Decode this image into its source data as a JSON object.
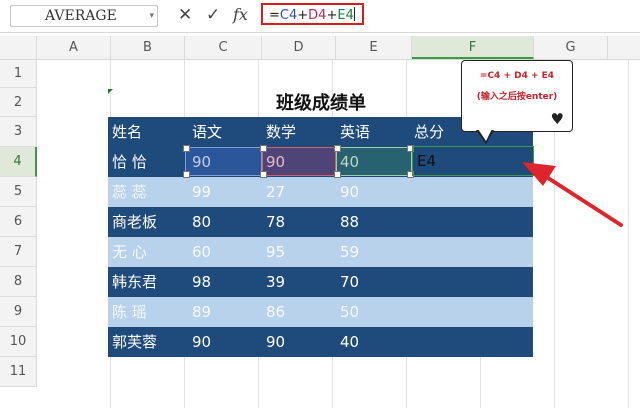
{
  "formula_bar": {
    "name_box": "AVERAGE",
    "cancel_icon": "✕",
    "confirm_icon": "✓",
    "fx_label": "fx",
    "formula": {
      "prefix": "=",
      "c_ref": "C4",
      "plus1": "+",
      "d_ref": "D4",
      "plus2": "+",
      "e_ref": "E4"
    }
  },
  "columns": [
    "A",
    "B",
    "C",
    "D",
    "E",
    "F",
    "G"
  ],
  "rows": [
    "1",
    "2",
    "3",
    "4",
    "5",
    "6",
    "7",
    "8",
    "9",
    "10",
    "11"
  ],
  "sheet": {
    "title": "班级成绩单",
    "headers": [
      "姓名",
      "语文",
      "数学",
      "英语",
      "总分"
    ],
    "records": [
      {
        "name": "恰  恰",
        "chinese": "90",
        "math": "90",
        "english": "40",
        "total": "E4"
      },
      {
        "name": "蕊  蕊",
        "chinese": "99",
        "math": "27",
        "english": "90",
        "total": ""
      },
      {
        "name": "商老板",
        "chinese": "80",
        "math": "78",
        "english": "88",
        "total": ""
      },
      {
        "name": "无  心",
        "chinese": "60",
        "math": "95",
        "english": "59",
        "total": ""
      },
      {
        "name": "韩东君",
        "chinese": "98",
        "math": "39",
        "english": "70",
        "total": ""
      },
      {
        "name": "陈  瑶",
        "chinese": "89",
        "math": "86",
        "english": "50",
        "total": ""
      },
      {
        "name": "郭芙蓉",
        "chinese": "90",
        "math": "90",
        "english": "40",
        "total": ""
      }
    ]
  },
  "callout": {
    "line1": "=C4 + D4 + E4",
    "line2": "(输入之后按enter)",
    "icon": "♥"
  },
  "colors": {
    "dark_row": "#1e4a7c",
    "light_row": "#b9d2eb",
    "accent_red": "#d21f1f",
    "active_green": "#3a9b45"
  }
}
